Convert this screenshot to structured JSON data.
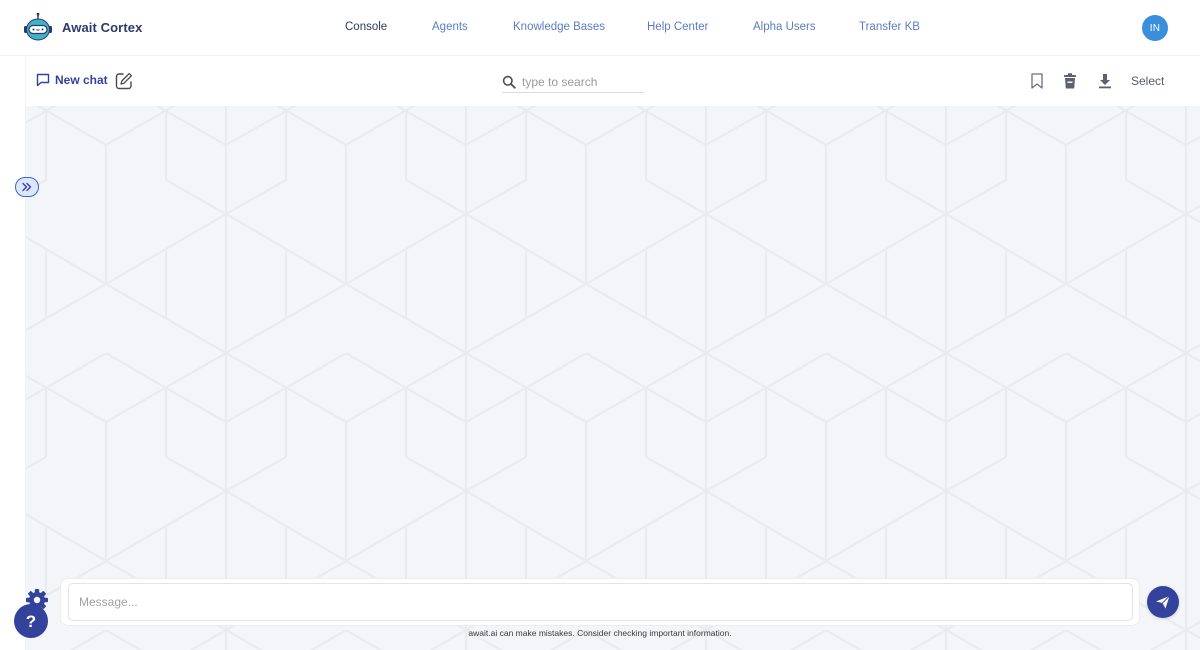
{
  "app": {
    "brand_name": "Await Cortex",
    "logo_icon": "robot-head-icon"
  },
  "nav": {
    "items": [
      {
        "label": "Console",
        "active": true
      },
      {
        "label": "Agents",
        "active": false
      },
      {
        "label": "Knowledge Bases",
        "active": false
      },
      {
        "label": "Help Center",
        "active": false
      },
      {
        "label": "Alpha Users",
        "active": false
      },
      {
        "label": "Transfer KB",
        "active": false
      }
    ]
  },
  "user": {
    "initials": "IN",
    "avatar_color": "#3a8fdc"
  },
  "toolbar": {
    "new_chat_label": "New chat",
    "new_chat_icon": "chat-bubble-icon",
    "compose_icon": "edit-square-icon",
    "search_placeholder": "type to search",
    "search_value": "",
    "bookmark_icon": "bookmark-icon",
    "delete_icon": "trash-icon",
    "download_icon": "download-icon",
    "select_label": "Select"
  },
  "sidebar": {
    "toggle_icon": "chevrons-right-icon",
    "collapsed": true
  },
  "composer": {
    "placeholder": "Message...",
    "value": "",
    "send_icon": "send-paper-plane-icon",
    "disclaimer": "await.ai can make mistakes. Consider checking important information."
  },
  "help_widget": {
    "icon": "help-gear-icon",
    "glyph": "?"
  },
  "colors": {
    "brand": "#33439b",
    "nav_link": "#5b7cc4",
    "nav_active": "#2f3b59",
    "canvas_bg": "#f3f5f9",
    "pattern_line": "#e8ebf0"
  }
}
